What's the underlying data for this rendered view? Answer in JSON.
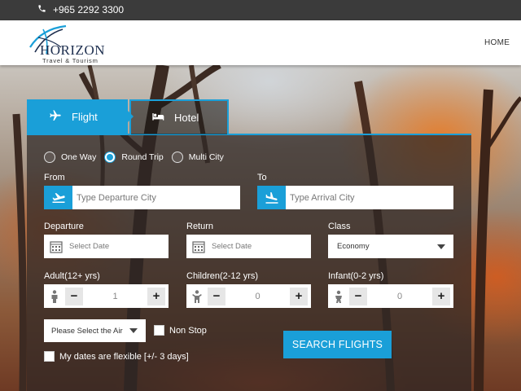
{
  "topbar": {
    "phone": "+965 2292 3300"
  },
  "logo": {
    "brand": "HORIZON",
    "tagline": "Travel & Tourism"
  },
  "nav": {
    "home": "HOME"
  },
  "tabs": [
    {
      "label": "Flight",
      "icon": "airplane-icon",
      "active": true
    },
    {
      "label": "Hotel",
      "icon": "bed-icon",
      "active": false
    }
  ],
  "trip_type": {
    "options": [
      "One Way",
      "Round Trip",
      "Multi City"
    ],
    "selected": "Round Trip"
  },
  "from": {
    "label": "From",
    "placeholder": "Type Departure City",
    "icon": "plane-takeoff-icon"
  },
  "to": {
    "label": "To",
    "placeholder": "Type Arrival City",
    "icon": "plane-landing-icon"
  },
  "departure": {
    "label": "Departure",
    "placeholder": "Select Date",
    "icon": "calendar-icon"
  },
  "return": {
    "label": "Return",
    "placeholder": "Select Date",
    "icon": "calendar-icon"
  },
  "class": {
    "label": "Class",
    "value": "Economy"
  },
  "adult": {
    "label": "Adult(12+ yrs)",
    "value": "1"
  },
  "children": {
    "label": "Children(2-12 yrs)",
    "value": "0"
  },
  "infant": {
    "label": "Infant(0-2 yrs)",
    "value": "0"
  },
  "airline": {
    "value": "Please Select the Air"
  },
  "non_stop": {
    "label": "Non Stop",
    "checked": false
  },
  "flexible": {
    "label": "My dates are flexible [+/- 3 days]",
    "checked": false
  },
  "search_button": "SEARCH FLIGHTS",
  "colors": {
    "accent": "#1a9fd8",
    "topbar": "#3b3b3b"
  }
}
